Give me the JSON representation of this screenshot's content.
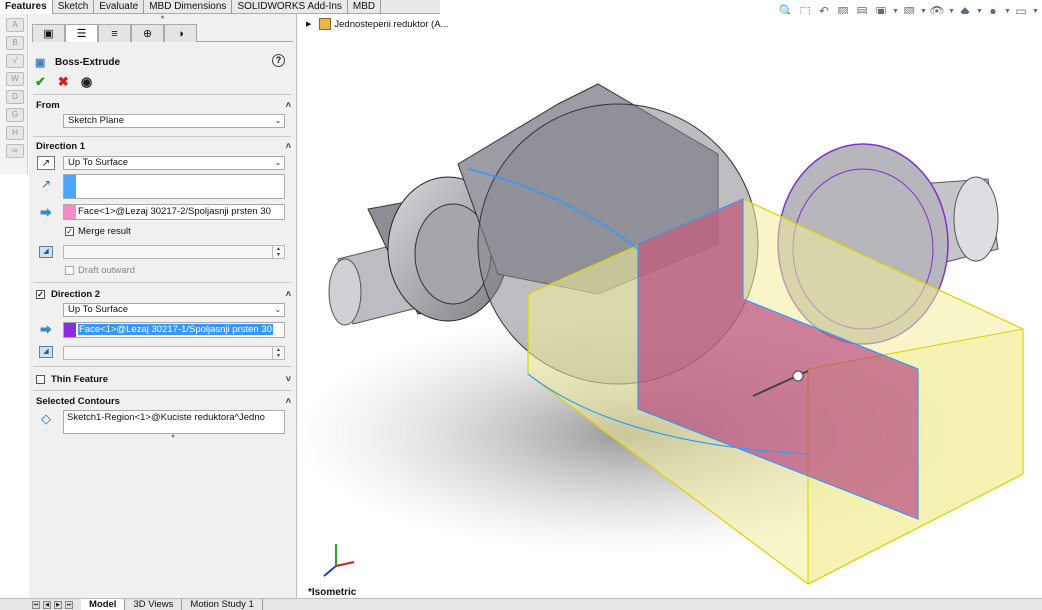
{
  "command_tabs": [
    "Features",
    "Sketch",
    "Evaluate",
    "MBD Dimensions",
    "SOLIDWORKS Add-Ins",
    "MBD"
  ],
  "active_command_tab": "Features",
  "feature": {
    "title": "Boss-Extrude",
    "help": "?"
  },
  "from": {
    "header": "From",
    "value": "Sketch Plane"
  },
  "direction1": {
    "header": "Direction 1",
    "end_condition": "Up To Surface",
    "face": "Face<1>@Lezaj 30217-2/Spoljasnji prsten 30",
    "merge_result": "Merge result",
    "draft_outward": "Draft outward"
  },
  "direction2": {
    "header": "Direction 2",
    "end_condition": "Up To Surface",
    "face": "Face<1>@Lezaj 30217-1/Spoljasnji prsten 30"
  },
  "thin_feature": {
    "header": "Thin Feature"
  },
  "selected_contours": {
    "header": "Selected Contours",
    "value": "Sketch1-Region<1>@Kuciste reduktora^Jedno"
  },
  "tree": {
    "item": "Jednostepeni reduktor  (A..."
  },
  "view_label": "*Isometric",
  "bottom_tabs": [
    "Model",
    "3D Views",
    "Motion Study 1"
  ],
  "active_bottom_tab": "Model",
  "colors": {
    "selection_blue": "#3399ff",
    "face1_swatch": "#f28cc4",
    "face2_swatch": "#8a2be2",
    "dir_swatch": "#4da6ff",
    "preview_yellow": "#f2ee9b",
    "preview_magenta": "#b0307a"
  }
}
